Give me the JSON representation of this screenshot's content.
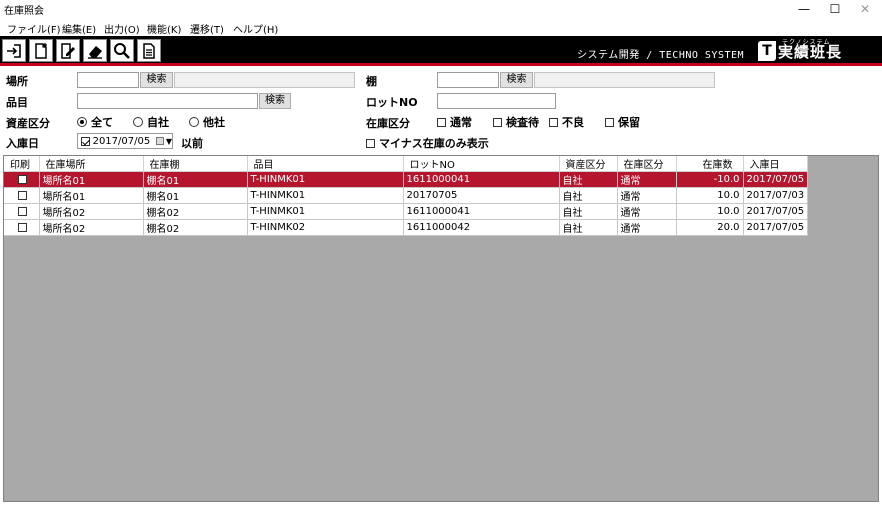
{
  "window": {
    "title": "在庫照会",
    "min": "—",
    "max": "☐",
    "close": "✕"
  },
  "menu": [
    "ファイル(F)",
    "編集(E)",
    "出力(O)",
    "機能(K)",
    "遷移(T)",
    "ヘルプ(H)"
  ],
  "toolbar": {
    "tagline": "システム開発 / TECHNO SYSTEM",
    "logo_mark": "T",
    "logo_text": "実績班長",
    "logo_sub": "テクノシステム"
  },
  "filters": {
    "location_label": "場所",
    "search_label": "検索",
    "shelf_label": "棚",
    "item_label": "品目",
    "lot_label": "ロットNO",
    "asset_label": "資産区分",
    "asset_options": [
      "全て",
      "自社",
      "他社"
    ],
    "asset_selected": 0,
    "stock_label": "在庫区分",
    "stock_options": [
      "通常",
      "検査待",
      "不良",
      "保留"
    ],
    "date_label": "入庫日",
    "date_value": "2017/07/05",
    "date_suffix": "以前",
    "minus_only": "マイナス在庫のみ表示"
  },
  "colors": {
    "accent": "#c8001e",
    "selected_row": "#b5162e",
    "grid_bg": "#a9a9a9"
  },
  "table": {
    "headers": [
      "印刷",
      "在庫場所",
      "在庫棚",
      "品目",
      "ロットNO",
      "資産区分",
      "在庫区分",
      "在庫数",
      "入庫日"
    ],
    "rows": [
      [
        "場所名01",
        "棚名01",
        "T-HINMK01",
        "1611000041",
        "自社",
        "通常",
        "-10.0",
        "2017/07/05"
      ],
      [
        "場所名01",
        "棚名01",
        "T-HINMK01",
        "20170705",
        "自社",
        "通常",
        "10.0",
        "2017/07/03"
      ],
      [
        "場所名02",
        "棚名02",
        "T-HINMK01",
        "1611000041",
        "自社",
        "通常",
        "10.0",
        "2017/07/05"
      ],
      [
        "場所名02",
        "棚名02",
        "T-HINMK02",
        "1611000042",
        "自社",
        "通常",
        "20.0",
        "2017/07/05"
      ]
    ],
    "selected_row": 0
  }
}
